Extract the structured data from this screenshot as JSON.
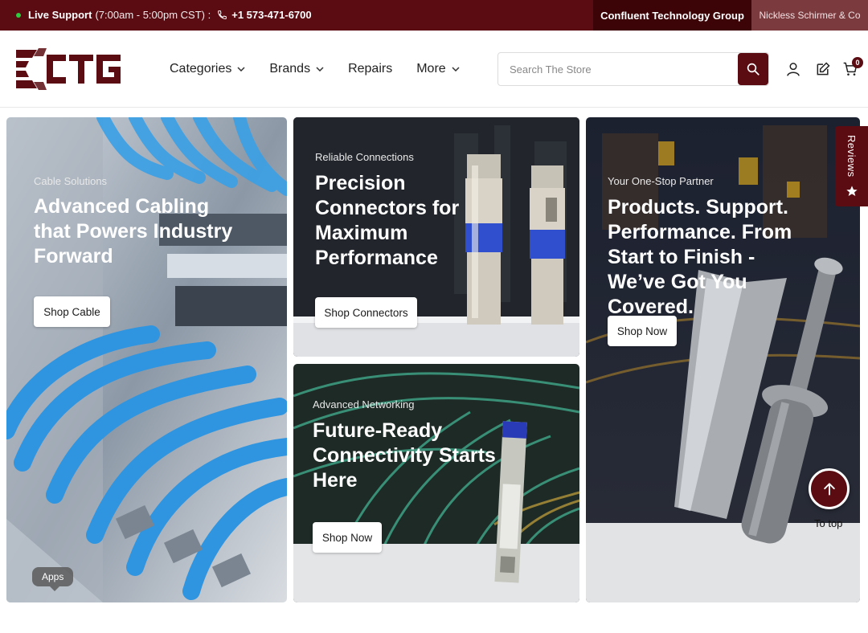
{
  "topbar": {
    "support_label": "Live Support",
    "support_hours": "(7:00am - 5:00pm CST) :",
    "phone": "+1 573-471-6700",
    "company_tab": "Confluent Technology Group",
    "partner_tab": "Nickless Schirmer & Co"
  },
  "header": {
    "logo_text": "CTG",
    "nav": [
      {
        "label": "Categories",
        "has_dropdown": true
      },
      {
        "label": "Brands",
        "has_dropdown": true
      },
      {
        "label": "Repairs",
        "has_dropdown": false
      },
      {
        "label": "More",
        "has_dropdown": true
      }
    ],
    "search_placeholder": "Search The Store",
    "cart_count": "0"
  },
  "banners": [
    {
      "eyebrow": "Cable Solutions",
      "title": "Advanced Cabling that Powers Industry Forward",
      "button": "Shop Cable"
    },
    {
      "eyebrow": "Reliable Connections",
      "title": "Precision Connectors for Maximum Performance",
      "button": "Shop Connectors"
    },
    {
      "eyebrow": "Advanced Networking",
      "title": "Future-Ready Connectivity Starts Here",
      "button": "Shop Now"
    },
    {
      "eyebrow": "Your One-Stop Partner",
      "title": "Products. Support. Performance. From Start to Finish - We’ve Got You Covered.",
      "button": "Shop Now"
    }
  ],
  "reviews_tab": "Reviews",
  "to_top_label": "To top",
  "apps_label": "Apps",
  "colors": {
    "brand": "#5a0c12",
    "brand_dark": "#3d0408",
    "status_online": "#2ecc40"
  }
}
